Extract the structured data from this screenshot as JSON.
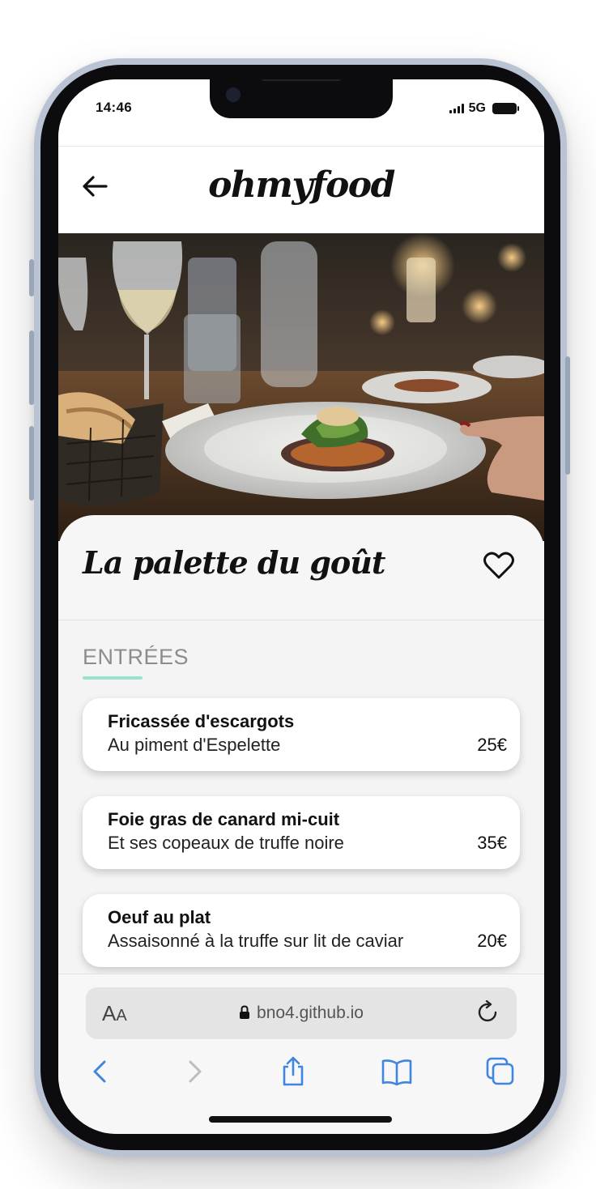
{
  "status_bar": {
    "time": "14:46",
    "network": "5G"
  },
  "header": {
    "logo": "ohmyfood"
  },
  "restaurant": {
    "name": "La palette du goût"
  },
  "menu": {
    "section_title": "ENTRÉES",
    "dishes": [
      {
        "name": "Fricassée d'escargots",
        "description": "Au piment d'Espelette",
        "price": "25€"
      },
      {
        "name": "Foie gras de canard mi-cuit",
        "description": "Et ses copeaux de truffe noire",
        "price": "35€"
      },
      {
        "name": "Oeuf au plat",
        "description": "Assaisonné à la truffe sur lit de caviar",
        "price": "20€"
      }
    ]
  },
  "browser": {
    "text_size_big": "A",
    "text_size_small": "A",
    "url": "bno4.github.io"
  },
  "colors": {
    "accent_underline": "#99e2d0",
    "browser_tint": "#3f86e0",
    "card_background": "#ffffff",
    "page_background": "#f4f4f4"
  },
  "icons": [
    "back-arrow-icon",
    "heart-icon",
    "lock-icon",
    "reload-icon",
    "chevron-left-icon",
    "chevron-right-icon",
    "share-icon",
    "bookmarks-icon",
    "tabs-icon"
  ]
}
